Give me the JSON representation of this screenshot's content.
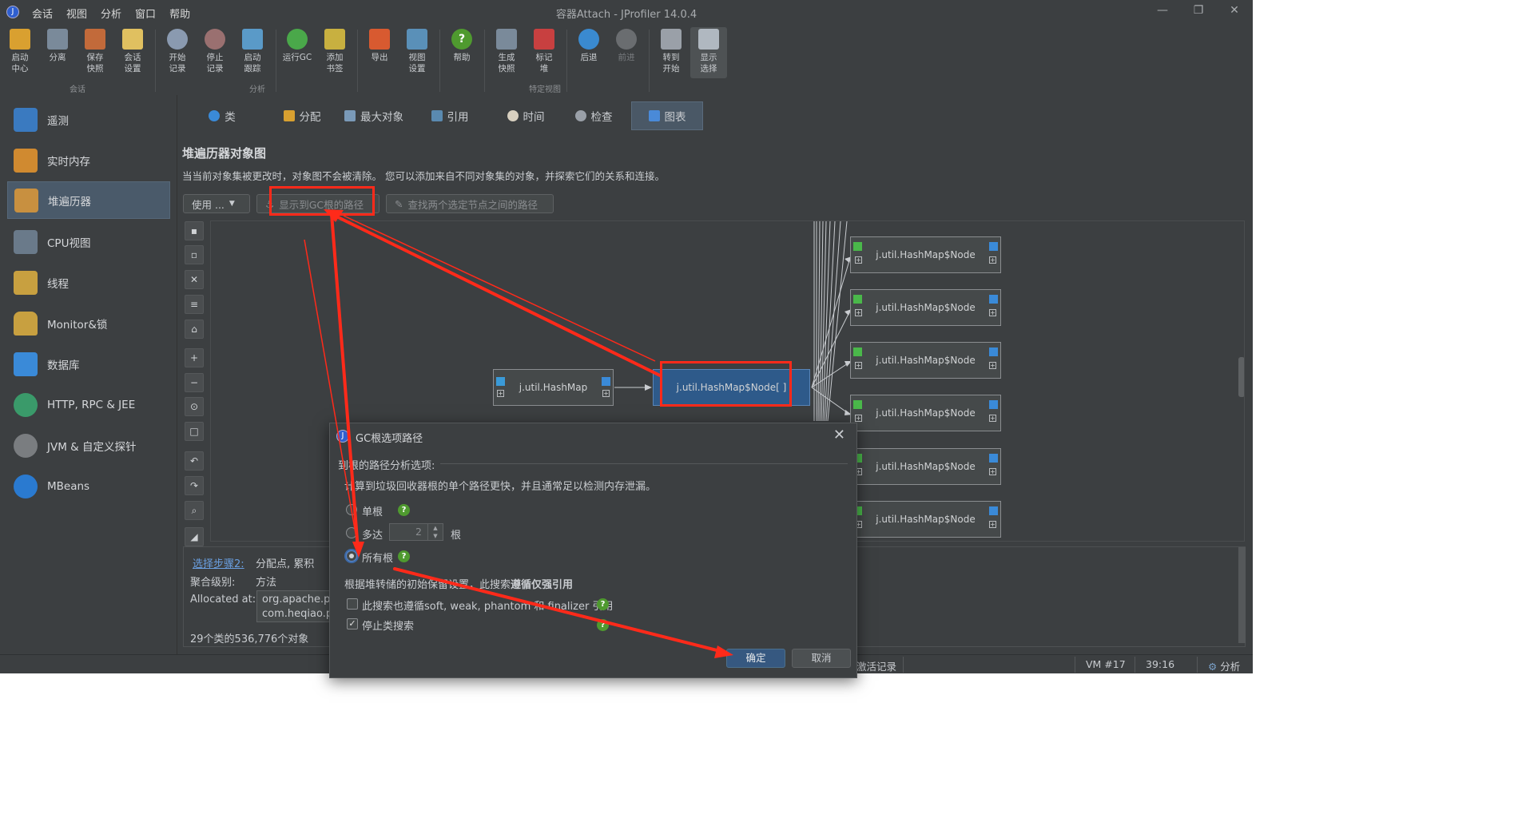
{
  "window": {
    "title": "容器Attach - JProfiler 14.0.4",
    "menu": [
      "会话",
      "视图",
      "分析",
      "窗口",
      "帮助"
    ]
  },
  "toolbar": {
    "buttons": [
      {
        "label": "启动\n中心",
        "icon": "start-center-icon"
      },
      {
        "label": "分离",
        "icon": "detach-icon"
      },
      {
        "label": "保存\n快照",
        "icon": "save-snapshot-icon"
      },
      {
        "label": "会话\n设置",
        "icon": "session-settings-icon"
      },
      {
        "label": "开始\n记录",
        "icon": "start-recording-icon"
      },
      {
        "label": "停止\n记录",
        "icon": "stop-recording-icon"
      },
      {
        "label": "启动\n跟踪",
        "icon": "start-tracking-icon"
      },
      {
        "label": "运行GC",
        "icon": "run-gc-icon"
      },
      {
        "label": "添加\n书签",
        "icon": "add-bookmark-icon"
      },
      {
        "label": "导出",
        "icon": "export-icon"
      },
      {
        "label": "视图\n设置",
        "icon": "view-settings-icon"
      },
      {
        "label": "帮助",
        "icon": "help-icon"
      },
      {
        "label": "生成\n快照",
        "icon": "snapshot-icon"
      },
      {
        "label": "标记\n堆",
        "icon": "mark-heap-icon"
      },
      {
        "label": "后退",
        "icon": "back-icon"
      },
      {
        "label": "前进",
        "icon": "forward-icon"
      },
      {
        "label": "转到\n开始",
        "icon": "go-home-icon"
      },
      {
        "label": "显示\n选择",
        "icon": "show-selection-icon"
      }
    ],
    "groups": [
      "会话",
      "分析",
      "特定视图"
    ]
  },
  "sidebar": {
    "items": [
      {
        "label": "遥测"
      },
      {
        "label": "实时内存"
      },
      {
        "label": "堆遍历器"
      },
      {
        "label": "CPU视图"
      },
      {
        "label": "线程"
      },
      {
        "label": "Monitor&锁"
      },
      {
        "label": "数据库"
      },
      {
        "label": "HTTP, RPC & JEE"
      },
      {
        "label": "JVM & 自定义探针"
      },
      {
        "label": "MBeans"
      }
    ]
  },
  "tabs": [
    {
      "label": "类"
    },
    {
      "label": "分配"
    },
    {
      "label": "最大对象"
    },
    {
      "label": "引用"
    },
    {
      "label": "时间"
    },
    {
      "label": "检查"
    },
    {
      "label": "图表"
    }
  ],
  "view": {
    "title": "堆遍历器对象图",
    "description": "当当前对象集被更改时，对象图不会被清除。 您可以添加来自不同对象集的对象，并探索它们的关系和连接。",
    "use_button": "使用 ...",
    "gc_path_button": "显示到GC根的路径",
    "find_path_button": "查找两个选定节点之间的路径"
  },
  "graph": {
    "hashmap": "j.util.HashMap",
    "node_array": "j.util.HashMap$Node[ ]",
    "nodes": [
      "j.util.HashMap$Node",
      "j.util.HashMap$Node",
      "j.util.HashMap$Node",
      "j.util.HashMap$Node",
      "j.util.HashMap$Node",
      "j.util.HashMap$Node"
    ]
  },
  "bottom": {
    "step_link": "选择步骤2:",
    "step_value": "分配点, 累积",
    "agg_label": "聚合级别:",
    "agg_value": "方法",
    "alloc_label": "Allocated at:",
    "alloc_line1": "org.apache.po",
    "alloc_line2": "com.heqiao.pl",
    "summary": "29个类的536,776个对象"
  },
  "status": {
    "recording": "激活记录",
    "vm": "VM #17",
    "time": "39:16",
    "mode": "分析"
  },
  "dialog": {
    "title": "GC根选项路径",
    "section": "到根的路径分析选项:",
    "description": "计算到垃圾回收器根的单个路径更快，并且通常足以检测内存泄漏。",
    "single_root": "单根",
    "up_to": "多达",
    "up_to_value": "2",
    "roots_unit": "根",
    "all_roots": "所有根",
    "retention_note_a": "根据堆转储的初始保留设置，此搜索",
    "retention_note_b": "遵循仅强引用",
    "soft_weak": "此搜索也遵循soft, weak, phantom 和 finalizer 引用",
    "stop_class": "停止类搜索",
    "ok": "确定",
    "cancel": "取消"
  },
  "colors": {
    "annotation": "#ff2a1a",
    "selected_node": "#2e5a8a",
    "primary_button": "#365880"
  }
}
